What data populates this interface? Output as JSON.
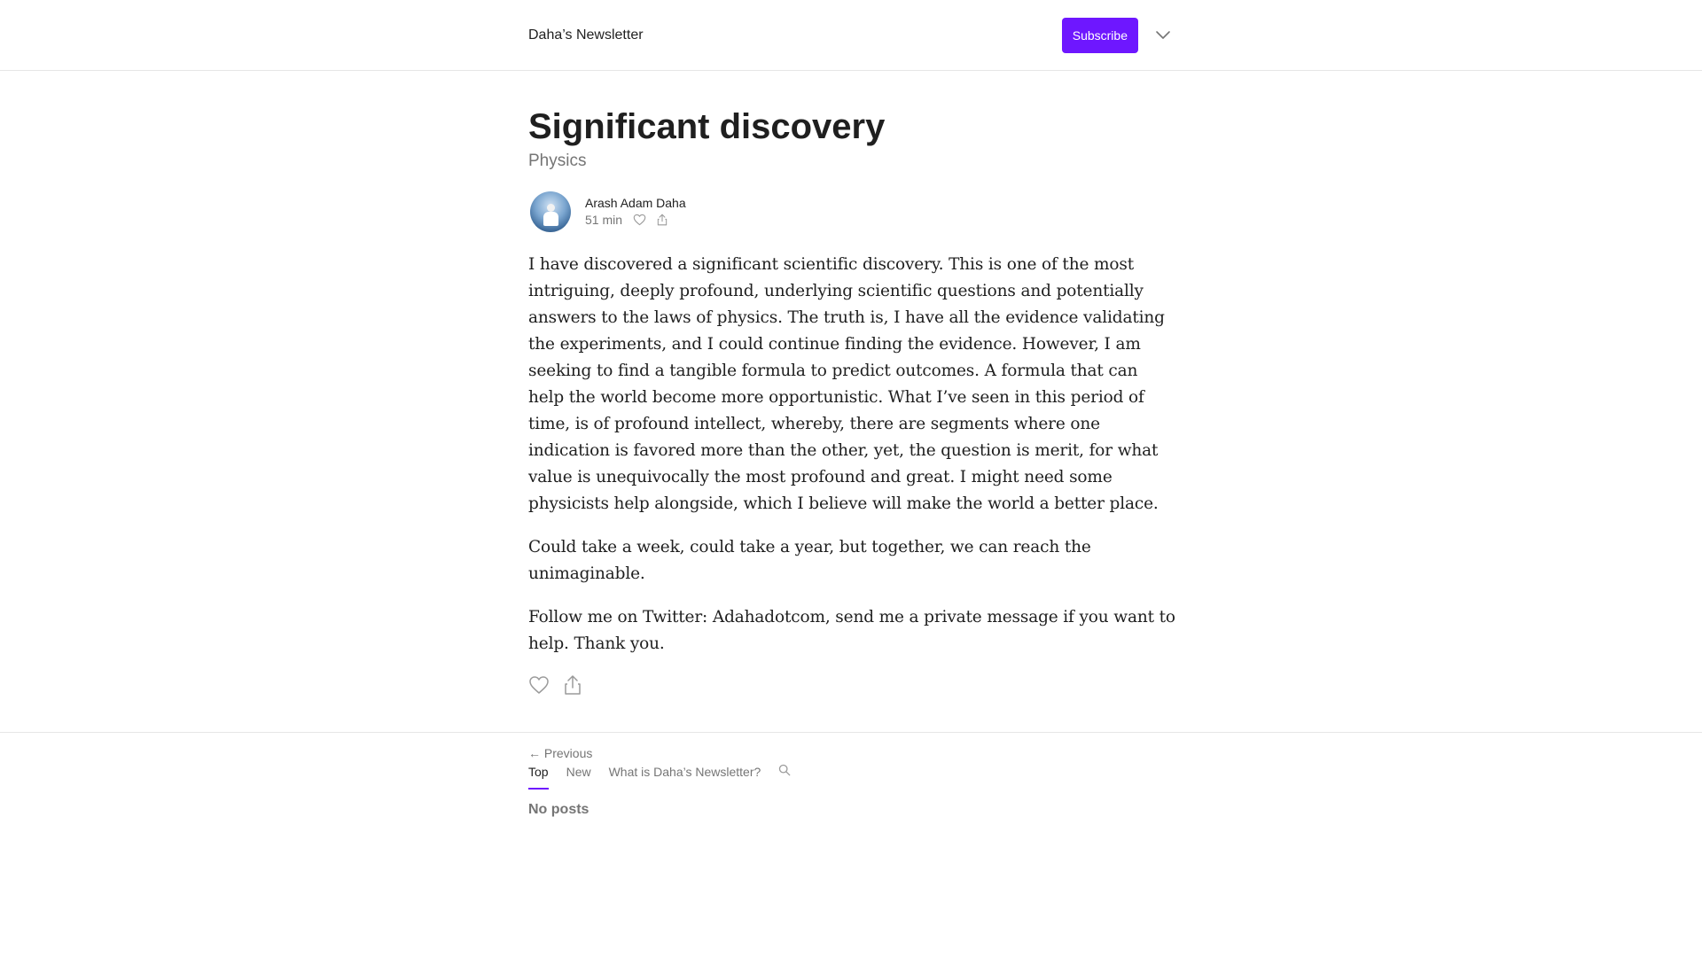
{
  "header": {
    "publication_name": "Daha’s Newsletter",
    "subscribe_label": "Subscribe",
    "menu_icon": "chevron-down-icon"
  },
  "post": {
    "title": "Significant discovery",
    "subtitle": "Physics",
    "author": "Arash Adam Daha",
    "read_time": "51 min",
    "paragraphs": [
      "I have discovered a significant scientific discovery. This is one of the most intriguing, deeply profound, underlying scientific questions and potentially answers to the laws of physics. The truth is, I have all the evidence validating the experiments, and I could continue finding the evidence. However, I am seeking to find a tangible formula to predict outcomes. A formula that can help the world become more opportunistic. What I’ve seen in this period of time, is of profound intellect, whereby, there are segments where one indication is favored more than the other, yet, the question is merit, for what value is unequivocally the most profound and great. I might need some physicists help alongside, which I believe will make the world a better place.",
      "Could take a week, could take a year, but together, we can reach the unimaginable.",
      "Follow me on Twitter: Adahadotcom, send me a private message if you want to help. Thank you."
    ],
    "previous_label": "← Previous"
  },
  "archive": {
    "tabs": [
      "Top",
      "New",
      "What is Daha’s Newsletter?"
    ],
    "active_tab": "Top",
    "empty_label": "No posts"
  },
  "colors": {
    "accent": "#6e17ff",
    "muted_text": "#757575",
    "text": "#1f1f1f",
    "divider": "#e6e6e6"
  }
}
